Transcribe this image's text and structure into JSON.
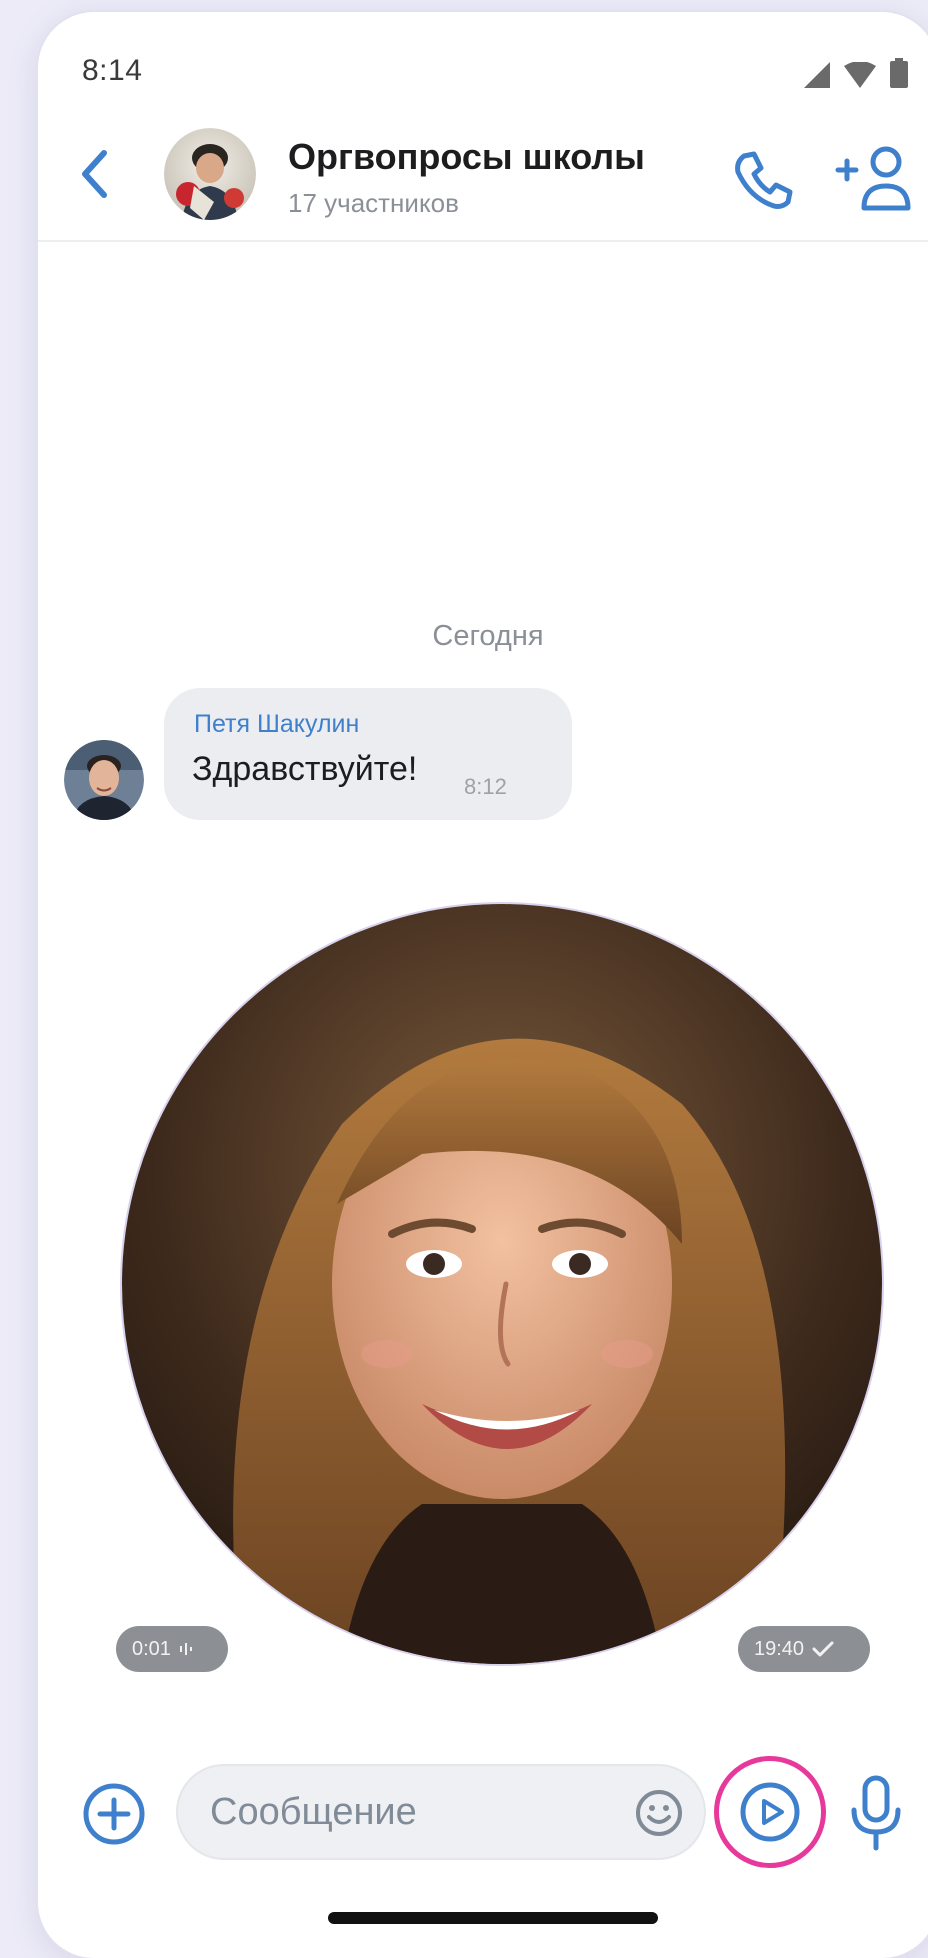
{
  "status_bar": {
    "time": "8:14",
    "icons": [
      "signal-icon",
      "wifi-icon",
      "battery-icon"
    ]
  },
  "header": {
    "back_icon": "chevron-left-icon",
    "title": "Оргвопросы школы",
    "subtitle": "17 участников",
    "call_icon": "phone-icon",
    "add_member_icon": "add-user-icon"
  },
  "chat": {
    "date_separator": "Сегодня",
    "messages": [
      {
        "author": "Петя Шакулин",
        "text": "Здравствуйте!",
        "time": "8:12"
      }
    ],
    "video_message": {
      "duration": "0:01",
      "time": "19:40",
      "status_icon": "check-icon"
    }
  },
  "composer": {
    "placeholder": "Сообщение",
    "value": "",
    "attach_icon": "plus-circle-icon",
    "emoji_icon": "smile-icon",
    "video_icon": "play-circle-icon",
    "mic_icon": "microphone-icon"
  },
  "colors": {
    "accent": "#3f80cd",
    "highlight": "#e6399b",
    "page_background": "#ecebf7"
  }
}
